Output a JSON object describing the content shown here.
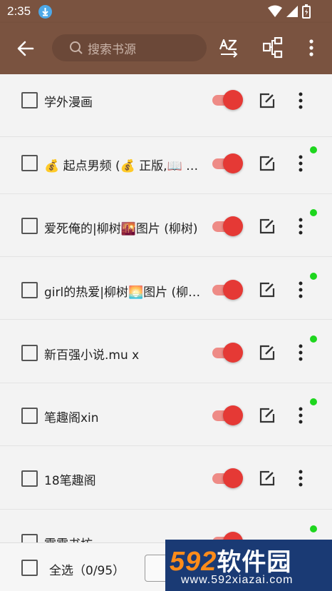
{
  "statusbar": {
    "time": "2:35"
  },
  "toolbar": {
    "search_placeholder": "搜索书源"
  },
  "rows": [
    {
      "name": "学外漫画",
      "enabled": true,
      "new": false
    },
    {
      "name": "💰 起点男频 (💰 正版,📖 精品)",
      "enabled": true,
      "new": true
    },
    {
      "name": "爱死俺的|柳树🌇图片 (柳树)",
      "enabled": true,
      "new": true
    },
    {
      "name": "girl的热爱|柳树🌅图片 (柳树)",
      "enabled": true,
      "new": true
    },
    {
      "name": "新百强小说.mu x",
      "enabled": true,
      "new": true
    },
    {
      "name": "笔趣阁xin",
      "enabled": true,
      "new": true
    },
    {
      "name": "18笔趣阁",
      "enabled": true,
      "new": false
    },
    {
      "name": "霹霹书坊",
      "enabled": true,
      "new": true
    }
  ],
  "bottom": {
    "select_all_label": "全选（0/95）"
  },
  "watermark": {
    "brand_num": "592",
    "brand_cn": "软件园",
    "url": "www.592xiazai.com"
  },
  "colors": {
    "toolbar": "#7a5340",
    "toggle_on": "#e53935",
    "new_dot": "#1ed61e"
  }
}
